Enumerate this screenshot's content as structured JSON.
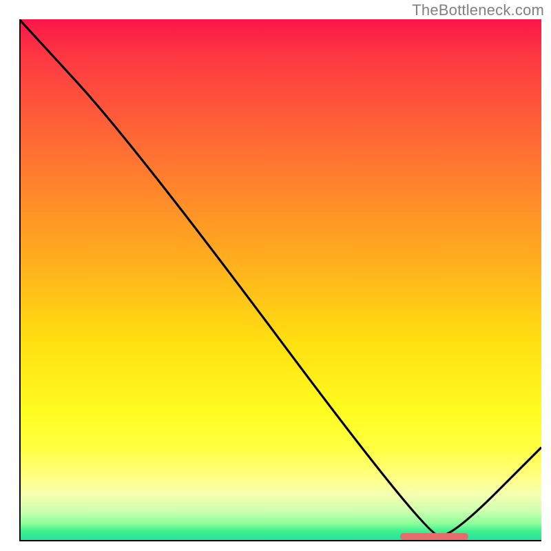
{
  "attribution": "TheBottleneck.com",
  "colors": {
    "curve_stroke": "#000000",
    "axis_stroke": "#000000",
    "accent_segment": "#e46d6c",
    "attribution_text": "#808080"
  },
  "chart_data": {
    "type": "line",
    "title": "",
    "xlabel": "",
    "ylabel": "",
    "xlim": [
      0,
      100
    ],
    "ylim": [
      0,
      100
    ],
    "series": [
      {
        "name": "curve",
        "x": [
          0,
          22,
          78,
          83,
          100
        ],
        "values": [
          100,
          76,
          1,
          1,
          18
        ]
      }
    ],
    "highlight_segment": {
      "x_start": 73,
      "x_end": 86
    }
  }
}
